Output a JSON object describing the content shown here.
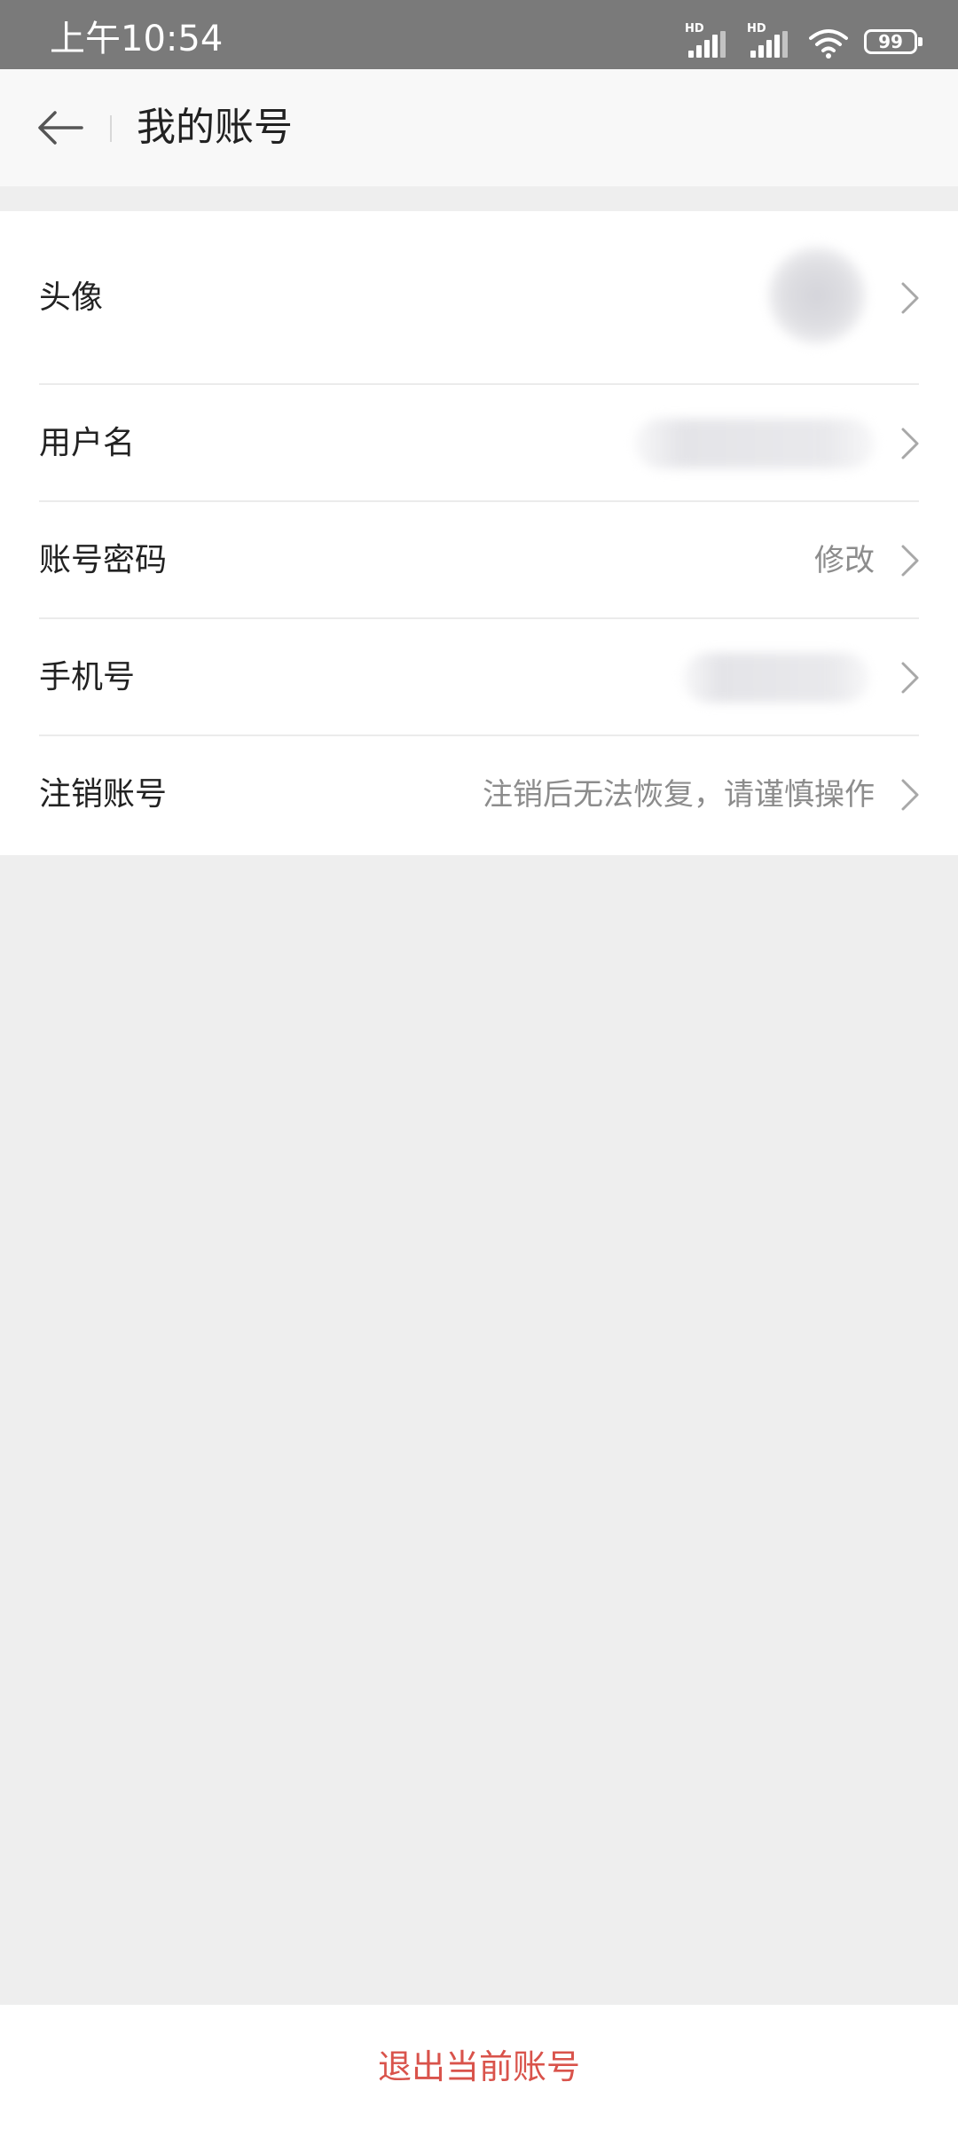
{
  "status_bar": {
    "time": "上午10:54",
    "signal_1_label": "HD",
    "signal_2_label": "HD",
    "battery": "99"
  },
  "header": {
    "title": "我的账号"
  },
  "rows": [
    {
      "label": "头像",
      "value": ""
    },
    {
      "label": "用户名",
      "value": ""
    },
    {
      "label": "账号密码",
      "value": "修改"
    },
    {
      "label": "手机号",
      "value": ""
    },
    {
      "label": "注销账号",
      "value": "注销后无法恢复，请谨慎操作"
    }
  ],
  "logout": {
    "label": "退出当前账号"
  },
  "colors": {
    "status_bar_bg": "#7A7A7A",
    "header_bg": "#F8F8F8",
    "page_bg": "#EEEEEE",
    "danger": "#D9534B",
    "secondary_text": "#8C8C8C"
  },
  "icons": {
    "back": "arrow-left-icon",
    "chevron": "chevron-right-icon",
    "wifi": "wifi-icon",
    "battery": "battery-icon",
    "signal": "signal-icon"
  }
}
